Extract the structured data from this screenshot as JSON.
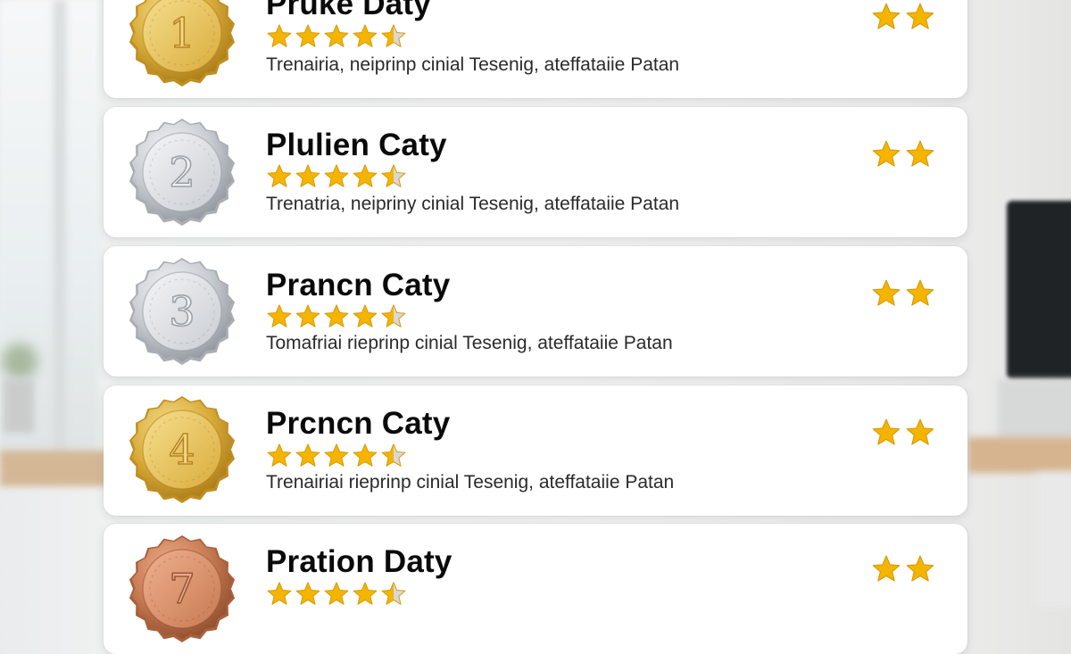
{
  "colors": {
    "star_gold": "#f4b400",
    "star_empty": "#d8d8d8",
    "text_primary": "#0a0a0a",
    "text_secondary": "#2a2a2a",
    "card_bg": "#ffffff"
  },
  "items": [
    {
      "rank": "1",
      "medal": "gold",
      "name": "Pruke Daty",
      "rating": 4.5,
      "description": "Trenairia, neiprinp cinial Tesenig, ateffataiie Patan",
      "fav_stars": 2
    },
    {
      "rank": "2",
      "medal": "silver",
      "name": "Plulien Caty",
      "rating": 4.5,
      "description": "Trenatria, neipriny cinial Tesenig, ateffataiie Patan",
      "fav_stars": 2
    },
    {
      "rank": "3",
      "medal": "silver",
      "name": "Prancn Caty",
      "rating": 4.5,
      "description": "Tomafriai rieprinp cinial Tesenig, ateffataiie Patan",
      "fav_stars": 2
    },
    {
      "rank": "4",
      "medal": "gold",
      "name": "Prcncn Caty",
      "rating": 4.5,
      "description": "Trenairiai rieprinp cinial Tesenig, ateffataiie Patan",
      "fav_stars": 2
    },
    {
      "rank": "7",
      "medal": "bronze",
      "name": "Pration Daty",
      "rating": 4.5,
      "description": "",
      "fav_stars": 2
    }
  ]
}
